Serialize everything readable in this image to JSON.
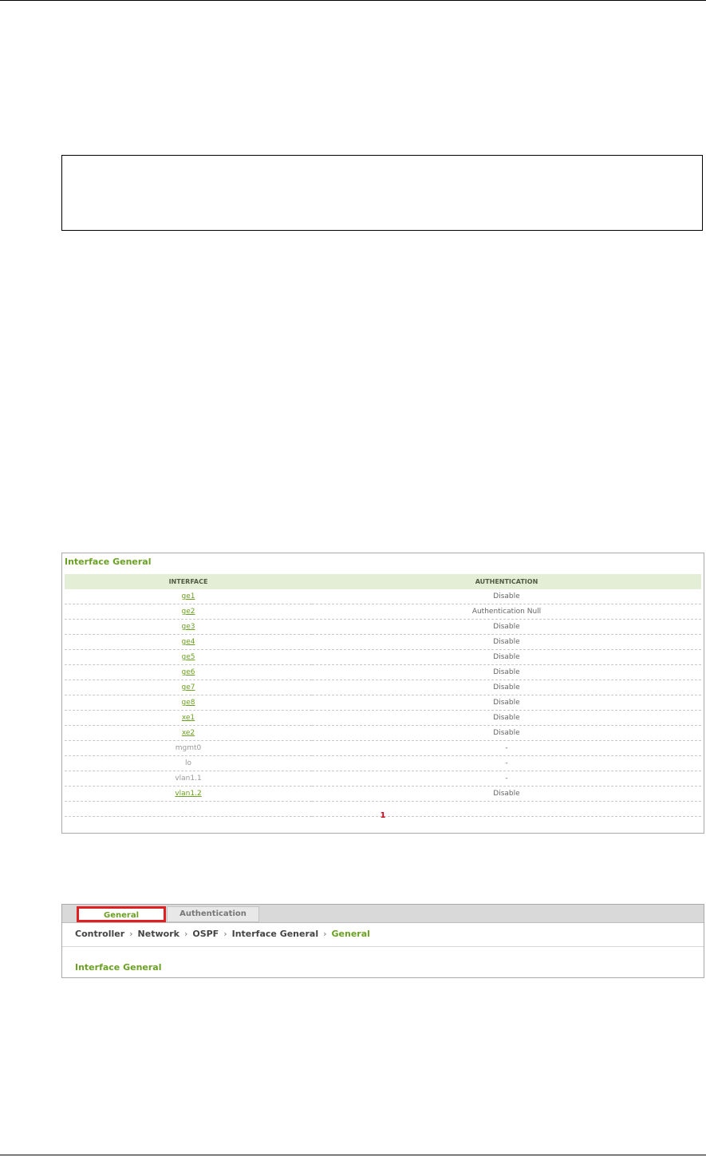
{
  "interface_list": {
    "title": "Interface General",
    "columns": [
      "INTERFACE",
      "AUTHENTICATION"
    ],
    "rows": [
      {
        "interface": "ge1",
        "authentication": "Disable",
        "link": true
      },
      {
        "interface": "ge2",
        "authentication": "Authentication Null",
        "link": true
      },
      {
        "interface": "ge3",
        "authentication": "Disable",
        "link": true
      },
      {
        "interface": "ge4",
        "authentication": "Disable",
        "link": true
      },
      {
        "interface": "ge5",
        "authentication": "Disable",
        "link": true
      },
      {
        "interface": "ge6",
        "authentication": "Disable",
        "link": true
      },
      {
        "interface": "ge7",
        "authentication": "Disable",
        "link": true
      },
      {
        "interface": "ge8",
        "authentication": "Disable",
        "link": true
      },
      {
        "interface": "xe1",
        "authentication": "Disable",
        "link": true
      },
      {
        "interface": "xe2",
        "authentication": "Disable",
        "link": true
      },
      {
        "interface": "mgmt0",
        "authentication": "-",
        "link": false
      },
      {
        "interface": "lo",
        "authentication": "-",
        "link": false
      },
      {
        "interface": "vlan1.1",
        "authentication": "-",
        "link": false
      },
      {
        "interface": "vlan1.2",
        "authentication": "Disable",
        "link": true
      }
    ],
    "page": "1"
  },
  "detail": {
    "tabs": {
      "general": "General",
      "authentication": "Authentication"
    },
    "breadcrumb": {
      "items": [
        "Controller",
        "Network",
        "OSPF",
        "Interface General"
      ],
      "current": "General",
      "separator": "›"
    },
    "section_title": "Interface General"
  },
  "colors": {
    "accent_green": "#6aa121",
    "header_bg": "#e4edd5",
    "highlight_red": "#e02020",
    "page_number_red": "#d0021b"
  }
}
